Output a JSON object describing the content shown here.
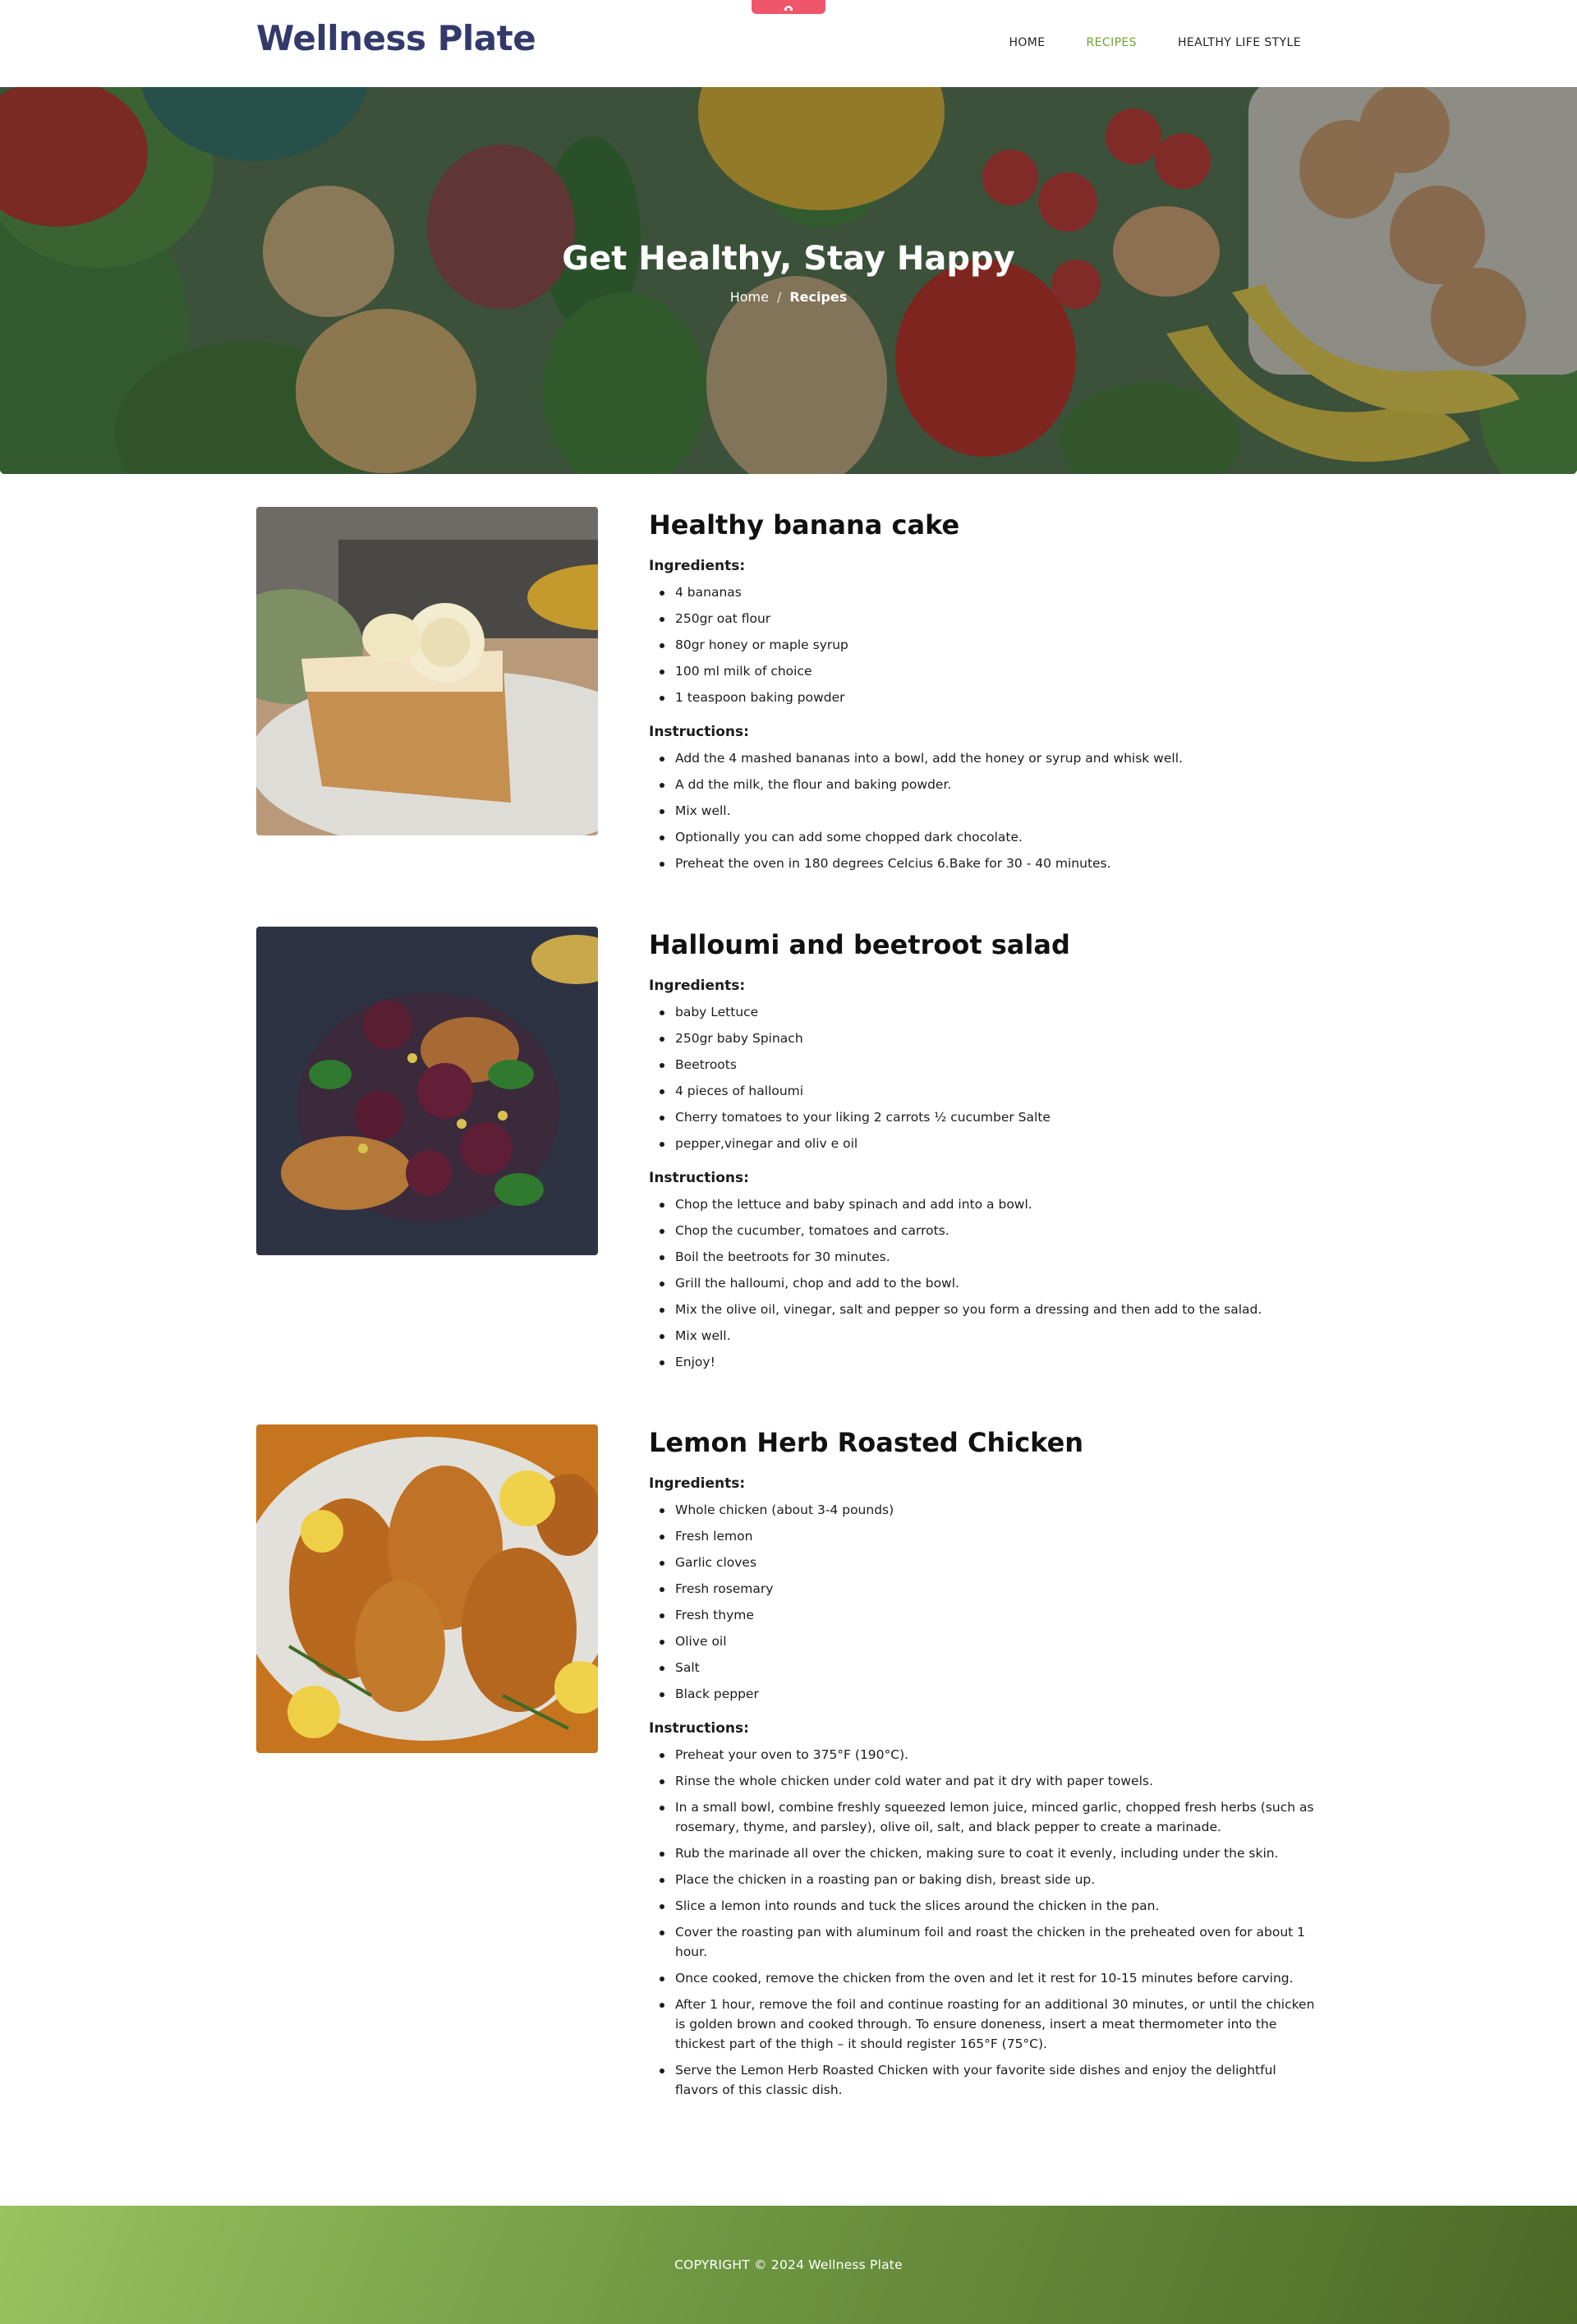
{
  "header": {
    "logo": "Wellness Plate",
    "nav": [
      {
        "label": "HOME"
      },
      {
        "label": "RECIPES",
        "active": true
      },
      {
        "label": "HEALTHY LIFE STYLE"
      }
    ],
    "accent_color": "#f0566a",
    "nav_active_color": "#6ea231",
    "logo_color": "#333a6b"
  },
  "hero": {
    "title": "Get Healthy, Stay Happy",
    "breadcrumb": {
      "home": "Home",
      "separator": "/",
      "current": "Recipes"
    }
  },
  "recipes": [
    {
      "title": "Healthy banana cake",
      "ingredients_label": "Ingredients:",
      "ingredients": [
        "4 bananas",
        "250gr oat flour",
        "80gr honey or maple syrup",
        "100 ml milk of choice",
        "1 teaspoon baking powder"
      ],
      "instructions_label": "Instructions:",
      "instructions": [
        "Add the 4 mashed bananas into a bowl, add the honey or syrup and whisk well.",
        "A dd the milk, the flour and baking powder.",
        "Mix well.",
        "Optionally you can add some chopped dark chocolate.",
        "Preheat the oven in 180 degrees Celcius 6.Bake for 30 - 40 minutes."
      ]
    },
    {
      "title": "Halloumi and beetroot salad",
      "ingredients_label": "Ingredients:",
      "ingredients": [
        "baby Lettuce",
        "250gr baby Spinach",
        "Beetroots",
        "4 pieces of halloumi",
        "Cherry tomatoes to your liking 2 carrots ½ cucumber Salte",
        "pepper,vinegar and oliv e oil"
      ],
      "instructions_label": "Instructions:",
      "instructions": [
        "Chop the lettuce and baby spinach and add into a bowl.",
        "Chop the cucumber, tomatoes and carrots.",
        "Boil the beetroots for 30 minutes.",
        "Grill the halloumi, chop and add to the bowl.",
        "Mix the olive oil, vinegar, salt and pepper so you form a dressing and then add to the salad.",
        "Mix well.",
        "Enjoy!"
      ]
    },
    {
      "title": "Lemon Herb Roasted Chicken",
      "ingredients_label": "Ingredients:",
      "ingredients": [
        "Whole chicken (about 3-4 pounds)",
        "Fresh lemon",
        "Garlic cloves",
        "Fresh rosemary",
        "Fresh thyme",
        "Olive oil",
        "Salt",
        "Black pepper"
      ],
      "instructions_label": "Instructions:",
      "instructions": [
        "Preheat your oven to 375°F (190°C).",
        "Rinse the whole chicken under cold water and pat it dry with paper towels.",
        "In a small bowl, combine freshly squeezed lemon juice, minced garlic, chopped fresh herbs (such as rosemary, thyme, and parsley), olive oil, salt, and black pepper to create a marinade.",
        "Rub the marinade all over the chicken, making sure to coat it evenly, including under the skin.",
        "Place the chicken in a roasting pan or baking dish, breast side up.",
        "Slice a lemon into rounds and tuck the slices around the chicken in the pan.",
        "Cover the roasting pan with aluminum foil and roast the chicken in the preheated oven for about 1 hour.",
        "Once cooked, remove the chicken from the oven and let it rest for 10-15 minutes before carving.",
        "After 1 hour, remove the foil and continue roasting for an additional 30 minutes, or until the chicken is golden brown and cooked through. To ensure doneness, insert a meat thermometer into the thickest part of the thigh – it should register 165°F (75°C).",
        "Serve the Lemon Herb Roasted Chicken with your favorite side dishes and enjoy the delightful flavors of this classic dish."
      ]
    }
  ],
  "footer": {
    "copyright": "COPYRIGHT © 2024 Wellness Plate"
  }
}
